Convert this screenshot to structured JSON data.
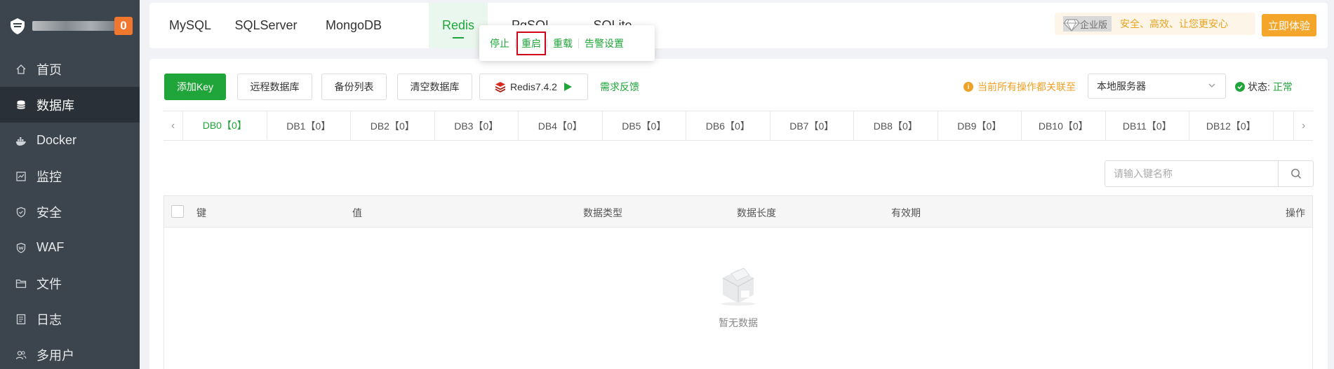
{
  "sidebar": {
    "badge": "0",
    "items": [
      {
        "label": "首页",
        "icon": "home-icon"
      },
      {
        "label": "数据库",
        "icon": "database-icon",
        "active": true
      },
      {
        "label": "Docker",
        "icon": "docker-icon"
      },
      {
        "label": "监控",
        "icon": "monitor-icon"
      },
      {
        "label": "安全",
        "icon": "shield-icon"
      },
      {
        "label": "WAF",
        "icon": "waf-shield-icon"
      },
      {
        "label": "文件",
        "icon": "folder-icon"
      },
      {
        "label": "日志",
        "icon": "log-icon"
      },
      {
        "label": "多用户",
        "icon": "users-icon"
      }
    ]
  },
  "topTabs": {
    "items": [
      "MySQL",
      "SQLServer",
      "MongoDB",
      "Redis",
      "PgSQL",
      "SQLite"
    ],
    "active": "Redis",
    "enterprise_tag": "企业版",
    "enterprise_slogan": "安全、高效、让您更安心",
    "try_button": "立即体验"
  },
  "popover": {
    "items": [
      "停止",
      "重启",
      "重载",
      "告警设置"
    ],
    "highlighted": "重启"
  },
  "toolbar": {
    "add_key": "添加Key",
    "remote_db": "远程数据库",
    "backup_list": "备份列表",
    "clear_db": "清空数据库",
    "redis_version": "Redis7.4.2",
    "feedback": "需求反馈",
    "notice": "当前所有操作都关联至",
    "server": "本地服务器",
    "status_label": "状态:",
    "status_value": "正常"
  },
  "dbTabs": [
    "DB0【0】",
    "DB1【0】",
    "DB2【0】",
    "DB3【0】",
    "DB4【0】",
    "DB5【0】",
    "DB6【0】",
    "DB7【0】",
    "DB8【0】",
    "DB9【0】",
    "DB10【0】",
    "DB11【0】",
    "DB12【0】"
  ],
  "search": {
    "placeholder": "请输入键名称"
  },
  "table": {
    "columns": [
      "键",
      "值",
      "数据类型",
      "数据长度",
      "有效期",
      "操作"
    ],
    "empty_text": "暂无数据"
  },
  "colors": {
    "brand_green": "#20a53a",
    "sidebar_bg": "#3c444d",
    "highlight_red": "#d0021b",
    "warning_orange": "#f0a023"
  }
}
